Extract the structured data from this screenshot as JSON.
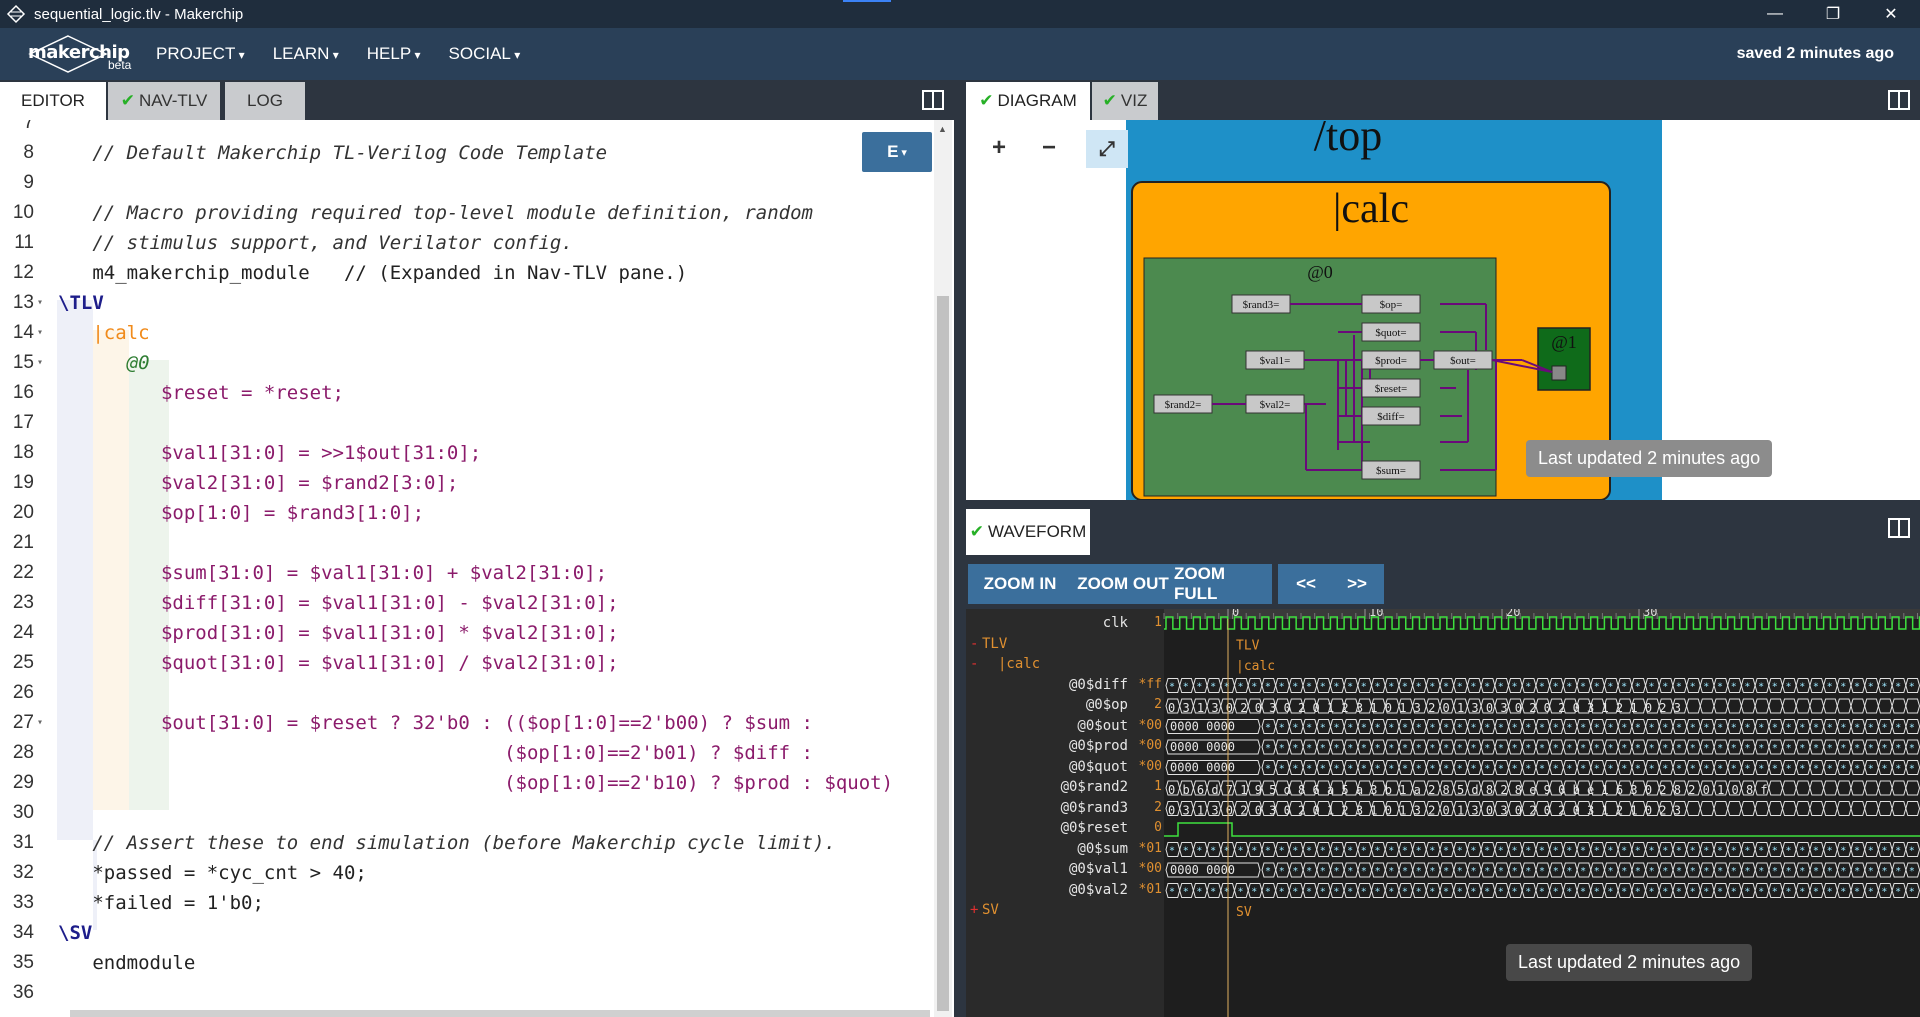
{
  "window": {
    "title": "sequential_logic.tlv - Makerchip",
    "controls": [
      "minimize",
      "restore",
      "close"
    ]
  },
  "menubar": {
    "brand": "makerchip",
    "beta": "beta",
    "items": [
      "PROJECT",
      "LEARN",
      "HELP",
      "SOCIAL"
    ],
    "saved_status": "saved 2 minutes ago"
  },
  "left_tabs": [
    {
      "label": "EDITOR",
      "check": false,
      "active": true
    },
    {
      "label": "NAV-TLV",
      "check": true,
      "active": false
    },
    {
      "label": "LOG",
      "check": false,
      "active": false
    }
  ],
  "editor": {
    "mode_button": "E",
    "lines": [
      {
        "n": "7",
        "text": ""
      },
      {
        "n": "8",
        "text": "   // Default Makerchip TL-Verilog Code Template"
      },
      {
        "n": "9",
        "text": ""
      },
      {
        "n": "10",
        "text": "   // Macro providing required top-level module definition, random"
      },
      {
        "n": "11",
        "text": "   // stimulus support, and Verilator config."
      },
      {
        "n": "12",
        "text": "   m4_makerchip_module   // (Expanded in Nav-TLV pane.)"
      },
      {
        "n": "13",
        "text": "\\TLV"
      },
      {
        "n": "14",
        "text": "   |calc"
      },
      {
        "n": "15",
        "text": "      @0"
      },
      {
        "n": "16",
        "text": "         $reset = *reset;"
      },
      {
        "n": "17",
        "text": ""
      },
      {
        "n": "18",
        "text": "         $val1[31:0] = >>1$out[31:0];"
      },
      {
        "n": "19",
        "text": "         $val2[31:0] = $rand2[3:0];"
      },
      {
        "n": "20",
        "text": "         $op[1:0] = $rand3[1:0];"
      },
      {
        "n": "21",
        "text": ""
      },
      {
        "n": "22",
        "text": "         $sum[31:0] = $val1[31:0] + $val2[31:0];"
      },
      {
        "n": "23",
        "text": "         $diff[31:0] = $val1[31:0] - $val2[31:0];"
      },
      {
        "n": "24",
        "text": "         $prod[31:0] = $val1[31:0] * $val2[31:0];"
      },
      {
        "n": "25",
        "text": "         $quot[31:0] = $val1[31:0] / $val2[31:0];"
      },
      {
        "n": "26",
        "text": ""
      },
      {
        "n": "27",
        "text": "         $out[31:0] = $reset ? 32'b0 : (($op[1:0]==2'b00) ? $sum :"
      },
      {
        "n": "28",
        "text": "                                       ($op[1:0]==2'b01) ? $diff :"
      },
      {
        "n": "29",
        "text": "                                       ($op[1:0]==2'b10) ? $prod : $quot)"
      },
      {
        "n": "30",
        "text": ""
      },
      {
        "n": "31",
        "text": "   // Assert these to end simulation (before Makerchip cycle limit)."
      },
      {
        "n": "32",
        "text": "   *passed = *cyc_cnt > 40;"
      },
      {
        "n": "33",
        "text": "   *failed = 1'b0;"
      },
      {
        "n": "34",
        "text": "\\SV"
      },
      {
        "n": "35",
        "text": "   endmodule"
      },
      {
        "n": "36",
        "text": ""
      }
    ]
  },
  "right_tabs": [
    {
      "label": "DIAGRAM",
      "check": true,
      "active": true
    },
    {
      "label": "VIZ",
      "check": true,
      "active": false
    }
  ],
  "diagram": {
    "zoom_in": "+",
    "zoom_out": "−",
    "fit": "⤢",
    "top_label": "/top",
    "calc_label": "|calc",
    "stage0_label": "@0",
    "stage1_label": "@1",
    "nodes": [
      "$rand3=",
      "$op=",
      "$quot=",
      "$val1=",
      "$prod=",
      "$out=",
      "$reset=",
      "$rand2=",
      "$val2=",
      "$diff=",
      "$sum="
    ],
    "last_updated": "Last updated 2 minutes ago"
  },
  "waveform": {
    "tab": "WAVEFORM",
    "buttons": [
      "ZOOM IN",
      "ZOOM OUT",
      "ZOOM FULL",
      "<<",
      ">>"
    ],
    "time_marks": [
      "0",
      "10",
      "20",
      "30"
    ],
    "signals": [
      {
        "name": "clk",
        "val": "1"
      },
      {
        "name": "TLV",
        "val": "",
        "group": "-"
      },
      {
        "name": "|calc",
        "val": "",
        "group": "-"
      },
      {
        "name": "@0$diff",
        "val": "*ff"
      },
      {
        "name": "@0$op",
        "val": "2"
      },
      {
        "name": "@0$out",
        "val": "*00"
      },
      {
        "name": "@0$prod",
        "val": "*00"
      },
      {
        "name": "@0$quot",
        "val": "*00"
      },
      {
        "name": "@0$rand2",
        "val": "1"
      },
      {
        "name": "@0$rand3",
        "val": "2"
      },
      {
        "name": "@0$reset",
        "val": "0"
      },
      {
        "name": "@0$sum",
        "val": "*01"
      },
      {
        "name": "@0$val1",
        "val": "*00"
      },
      {
        "name": "@0$val2",
        "val": "*01"
      },
      {
        "name": "SV",
        "val": "",
        "group": "+"
      }
    ],
    "wave_labels": {
      "tlv": "TLV",
      "calc": "|calc",
      "sv": "SV",
      "out_first": "0000_0000",
      "prod_first": "0000_0000",
      "quot_first": "0000_0000",
      "val1_first": "0000_0000",
      "op_digits": "0 3 1 3 0 2 0   3 0   2 0 1 2   3 1 0 1 3 2 0 1   3   0 3 0 2 0 2 0 3 1   2   1 0   2 3",
      "rand2_digits": "0 b 6 d 7 1 9 5 d 8   6 a 5 a 3 b 1 a 2 8 5 d 8 2   8 e 9 0 b e 1 6 3 0 2 8 2 0 1 0 8   f",
      "rand3_digits": "0 3 1 3 0 2 0   3 0   2 0 1 2   3 1 0 1 3 2 0 1   3   0 3 0 2 0 2 0 3 1   2   1 0   2 3"
    },
    "last_updated": "Last updated 2 minutes ago"
  }
}
